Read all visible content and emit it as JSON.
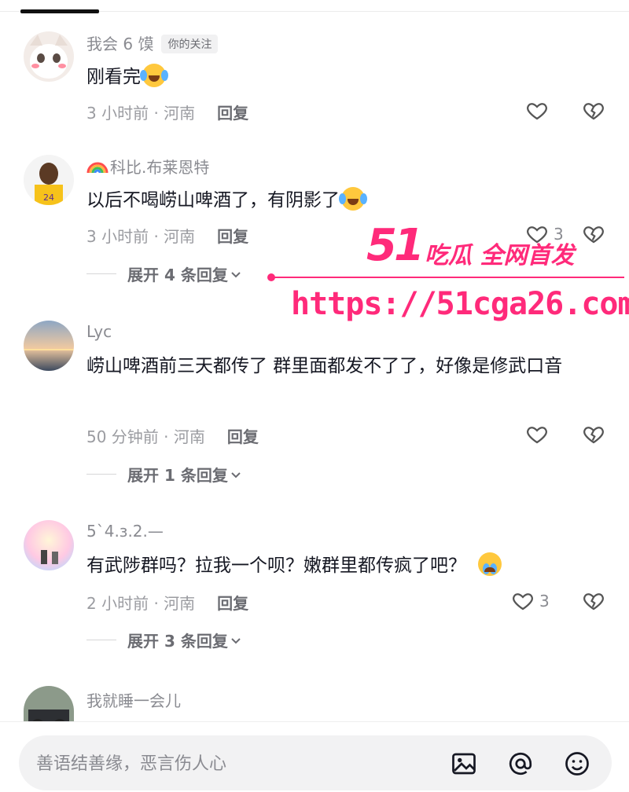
{
  "comments": [
    {
      "user": "我会 6 馍",
      "badge": "你的关注",
      "text": "刚看完",
      "time_loc": "3 小时前 · 河南",
      "reply_label": "回复",
      "like_count": ""
    },
    {
      "user": "科比.布莱恩特",
      "text": "以后不喝崂山啤酒了，有阴影了",
      "time_loc": "3 小时前 · 河南",
      "reply_label": "回复",
      "like_count": "3",
      "expand_label": "展开 4 条回复"
    },
    {
      "user": "Lyc",
      "text": "崂山啤酒前三天都传了 群里面都发不了了，好像是修武口音",
      "time_loc": "50 分钟前 · 河南",
      "reply_label": "回复",
      "like_count": "",
      "expand_label": "展开 1 条回复"
    },
    {
      "user": "5`4.з.2.—",
      "text": "有武陟群吗？拉我一个呗？嫩群里都传疯了吧？",
      "time_loc": "2 小时前 · 河南",
      "reply_label": "回复",
      "like_count": "3",
      "expand_label": "展开 3 条回复"
    },
    {
      "user": "我就睡一会儿",
      "text": ""
    }
  ],
  "watermark": {
    "logo_number": "51",
    "slogan": "吃瓜 全网首发",
    "url": "https://51cga26.com"
  },
  "composer": {
    "placeholder": "善语结善缘，恶言伤人心",
    "icons": [
      "image-icon",
      "at-icon",
      "emoji-icon"
    ]
  },
  "colors": {
    "watermark": "#ff2a7a",
    "meta_text": "#9b9ca1",
    "body_text": "#161823"
  }
}
